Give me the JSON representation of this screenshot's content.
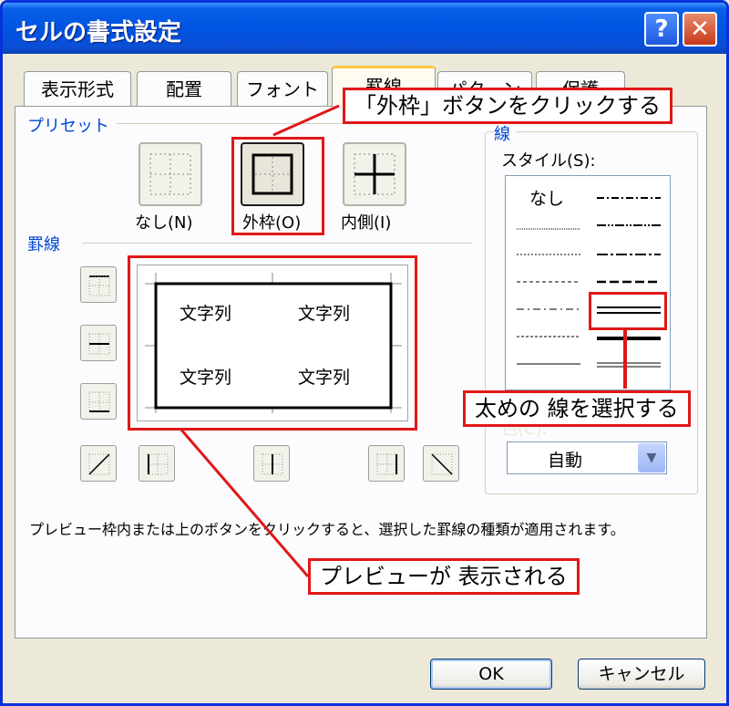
{
  "window": {
    "title": "セルの書式設定",
    "help_button": "?",
    "close_button": "✕"
  },
  "tabs": [
    {
      "label": "表示形式",
      "active": false
    },
    {
      "label": "配置",
      "active": false
    },
    {
      "label": "フォント",
      "active": false
    },
    {
      "label": "罫線",
      "active": true
    },
    {
      "label": "パターン",
      "active": false
    },
    {
      "label": "保護",
      "active": false
    }
  ],
  "preset": {
    "group_label": "プリセット",
    "buttons": [
      {
        "label": "なし(N)",
        "icon": "no-border-icon",
        "selected": false
      },
      {
        "label": "外枠(O)",
        "icon": "outline-border-icon",
        "selected": true
      },
      {
        "label": "内側(I)",
        "icon": "inside-border-icon",
        "selected": false
      }
    ]
  },
  "border": {
    "group_label": "罫線",
    "buttons": [
      {
        "icon": "top-border-icon"
      },
      {
        "icon": "middle-horizontal-border-icon"
      },
      {
        "icon": "bottom-border-icon"
      },
      {
        "icon": "diagonal-up-border-icon"
      },
      {
        "icon": "left-border-icon"
      },
      {
        "icon": "middle-vertical-border-icon"
      },
      {
        "icon": "right-border-icon"
      },
      {
        "icon": "diagonal-down-border-icon"
      }
    ],
    "preview_cells": [
      "文字列",
      "文字列",
      "文字列",
      "文字列"
    ]
  },
  "line": {
    "group_label": "線",
    "style_label": "スタイル(S):",
    "none_label": "なし",
    "selected_style": "double",
    "color_label": "色(C):",
    "color_value": "自動"
  },
  "description": "プレビュー枠内または上のボタンをクリックすると、選択した罫線の種類が適用されます。",
  "buttons": {
    "ok": "OK",
    "cancel": "キャンセル"
  },
  "annotations": {
    "outline_button": "「外枠」ボタンをクリックする",
    "thick_line": "太めの 線を選択する",
    "preview": "プレビューが 表示される"
  },
  "colors": {
    "titlebar": "#0054e3",
    "group_label": "#0046d5",
    "annotation": "#e01818",
    "dialog_bg": "#ece9d8"
  }
}
